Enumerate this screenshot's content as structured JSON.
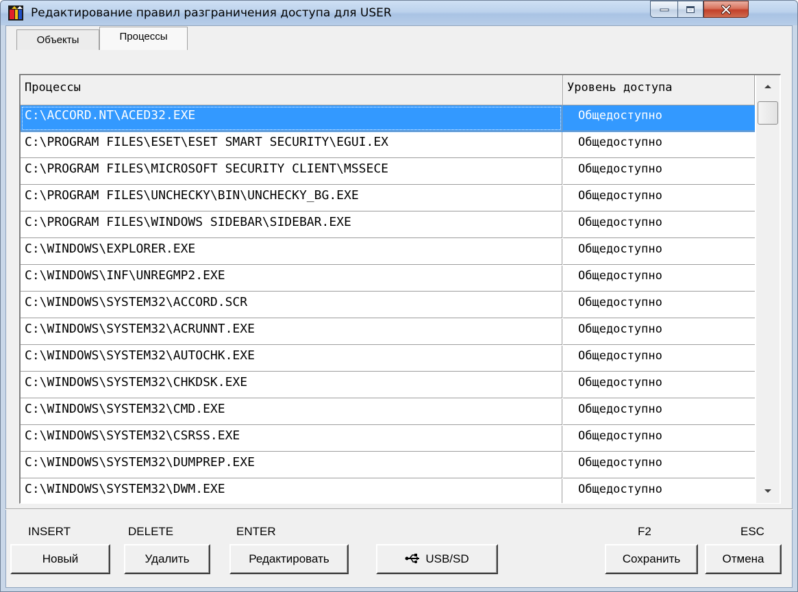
{
  "window": {
    "title": "Редактирование правил разграничения доступа для USER"
  },
  "tabs": [
    {
      "label": "Объекты"
    },
    {
      "label": "Процессы"
    }
  ],
  "list": {
    "columns": [
      "Процессы",
      "Уровень доступа"
    ],
    "rows": [
      {
        "path": "C:\\ACCORD.NT\\ACED32.EXE",
        "level": "Общедоступно"
      },
      {
        "path": "C:\\PROGRAM FILES\\ESET\\ESET SMART SECURITY\\EGUI.EX",
        "level": "Общедоступно"
      },
      {
        "path": "C:\\PROGRAM FILES\\MICROSOFT SECURITY CLIENT\\MSSECE",
        "level": "Общедоступно"
      },
      {
        "path": "C:\\PROGRAM FILES\\UNCHECKY\\BIN\\UNCHECKY_BG.EXE",
        "level": "Общедоступно"
      },
      {
        "path": "C:\\PROGRAM FILES\\WINDOWS SIDEBAR\\SIDEBAR.EXE",
        "level": "Общедоступно"
      },
      {
        "path": "C:\\WINDOWS\\EXPLORER.EXE",
        "level": "Общедоступно"
      },
      {
        "path": "C:\\WINDOWS\\INF\\UNREGMP2.EXE",
        "level": "Общедоступно"
      },
      {
        "path": "C:\\WINDOWS\\SYSTEM32\\ACCORD.SCR",
        "level": "Общедоступно"
      },
      {
        "path": "C:\\WINDOWS\\SYSTEM32\\ACRUNNT.EXE",
        "level": "Общедоступно"
      },
      {
        "path": "C:\\WINDOWS\\SYSTEM32\\AUTOCHK.EXE",
        "level": "Общедоступно"
      },
      {
        "path": "C:\\WINDOWS\\SYSTEM32\\CHKDSK.EXE",
        "level": "Общедоступно"
      },
      {
        "path": "C:\\WINDOWS\\SYSTEM32\\CMD.EXE",
        "level": "Общедоступно"
      },
      {
        "path": "C:\\WINDOWS\\SYSTEM32\\CSRSS.EXE",
        "level": "Общедоступно"
      },
      {
        "path": "C:\\WINDOWS\\SYSTEM32\\DUMPREP.EXE",
        "level": "Общедоступно"
      },
      {
        "path": "C:\\WINDOWS\\SYSTEM32\\DWM.EXE",
        "level": "Общедоступно"
      }
    ]
  },
  "hotkeys": {
    "insert": "INSERT",
    "delete": "DELETE",
    "enter": "ENTER",
    "f2": "F2",
    "esc": "ESC"
  },
  "buttons": {
    "new": "Новый",
    "delete": "Удалить",
    "edit": "Редактировать",
    "usb": "USB/SD",
    "save": "Сохранить",
    "cancel": "Отмена"
  },
  "icons": {
    "app": "accord-app-icon",
    "usb": "usb-icon"
  }
}
